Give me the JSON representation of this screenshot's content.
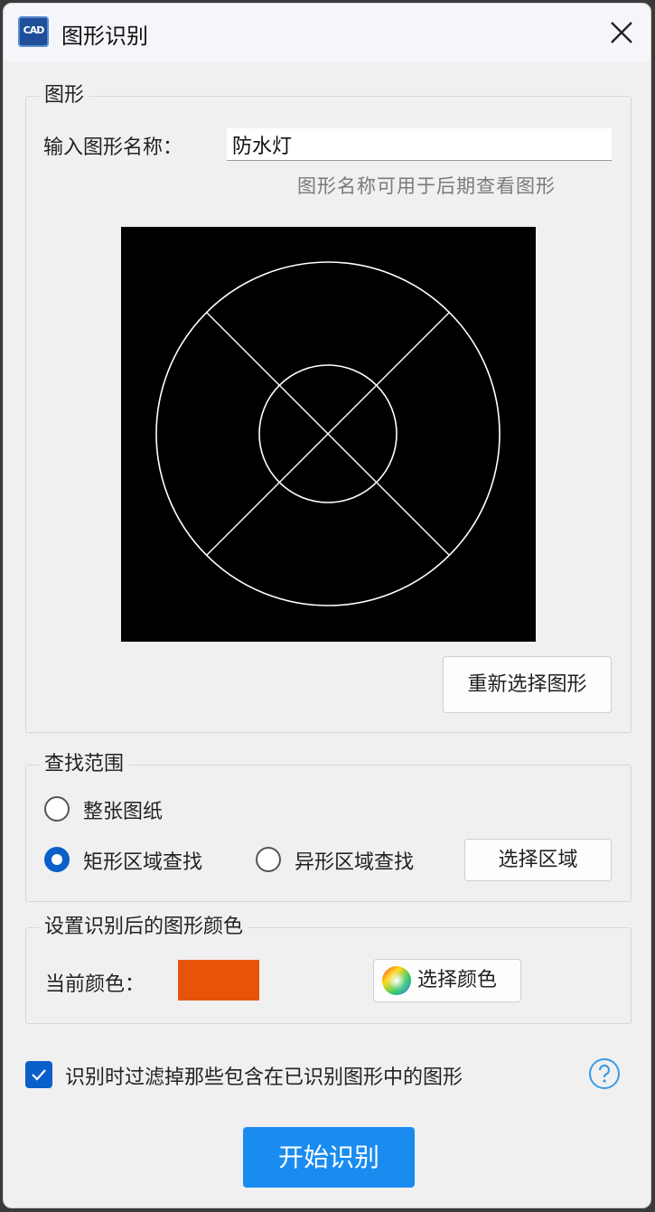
{
  "window": {
    "title": "图形识别",
    "icon_text": "CAD"
  },
  "shape_group": {
    "legend": "图形",
    "name_label": "输入图形名称：",
    "name_value": "防水灯",
    "hint": "图形名称可用于后期查看图形",
    "reselect_button": "重新选择图形"
  },
  "search_group": {
    "legend": "查找范围",
    "options": [
      {
        "label": "整张图纸",
        "checked": false
      },
      {
        "label": "矩形区域查找",
        "checked": true
      },
      {
        "label": "异形区域查找",
        "checked": false
      }
    ],
    "select_area_button": "选择区域"
  },
  "color_group": {
    "legend": "设置识别后的图形颜色",
    "current_label": "当前颜色：",
    "current_color": "#e8530a",
    "choose_button": "选择颜色"
  },
  "filter_checkbox": {
    "label": "识别时过滤掉那些包含在已识别图形中的图形",
    "checked": true
  },
  "start_button": "开始识别",
  "colors": {
    "accent": "#1a8cf0",
    "checkbox": "#0a5fc8"
  }
}
